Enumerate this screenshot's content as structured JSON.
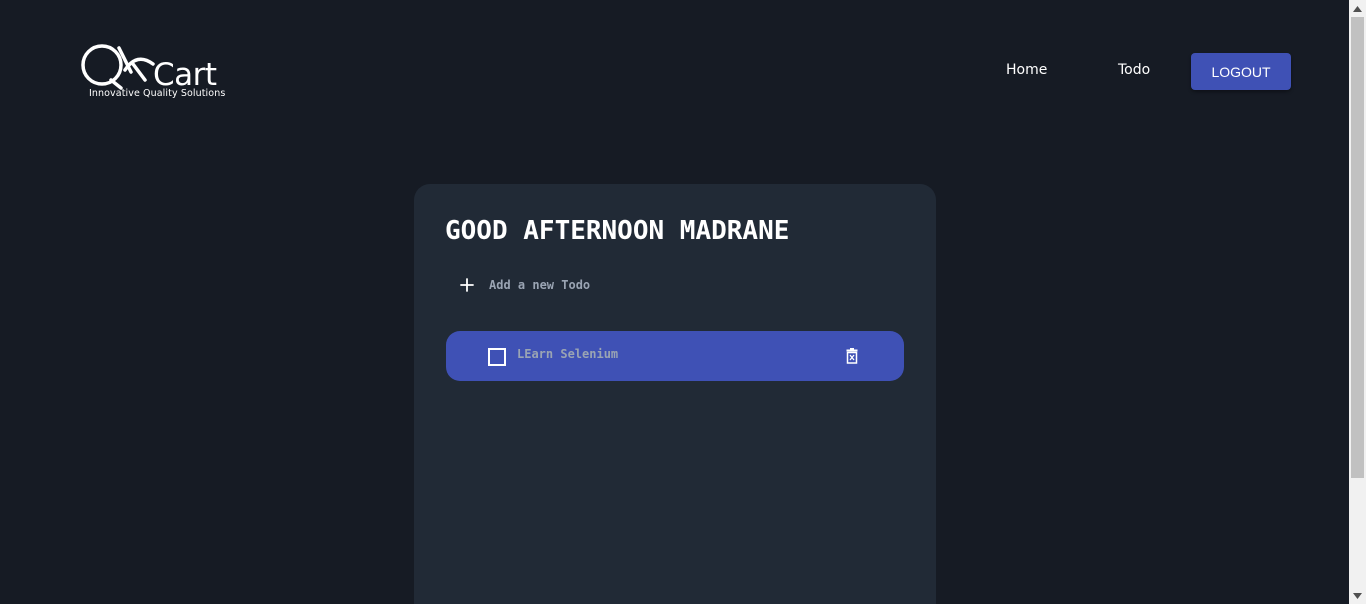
{
  "header": {
    "logo": {
      "wordmark": "QkCart",
      "tagline": "Innovative Quality Solutions"
    },
    "nav": {
      "home_label": "Home",
      "todo_label": "Todo",
      "logout_label": "LOGOUT"
    }
  },
  "main": {
    "greeting": "GOOD AFTERNOON MADRANE",
    "add_todo_label": "Add a new Todo",
    "add_icon": "plus-icon",
    "todos": [
      {
        "text": "LEarn Selenium",
        "completed": false,
        "checkbox_icon": "checkbox-icon",
        "delete_icon": "trash-icon"
      }
    ]
  },
  "colors": {
    "background": "#161b24",
    "card": "#212a36",
    "accent": "#3f51b5",
    "muted_text": "#9aa4b3"
  }
}
